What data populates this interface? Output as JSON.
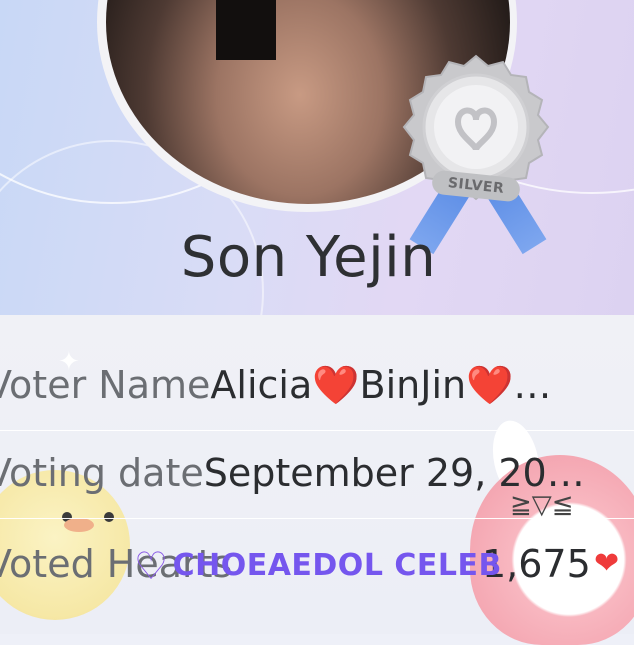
{
  "profile": {
    "name": "Son Yejin",
    "badge_label": "SILVER"
  },
  "details": {
    "voter_label": "Voter Name",
    "voter_value": "Alicia❤️BinJin❤️…",
    "date_label": "Voting date",
    "date_value": "September 29, 20…",
    "hearts_label": "Voted Hearts",
    "hearts_value": "1,675",
    "hearts_icon": "❤"
  },
  "watermark": {
    "text": "CHOEAEDOL CELEB"
  },
  "colors": {
    "brand": "#7556ee",
    "badge_ribbon": "#5f8fe6",
    "heart": "#ef3b3b"
  }
}
